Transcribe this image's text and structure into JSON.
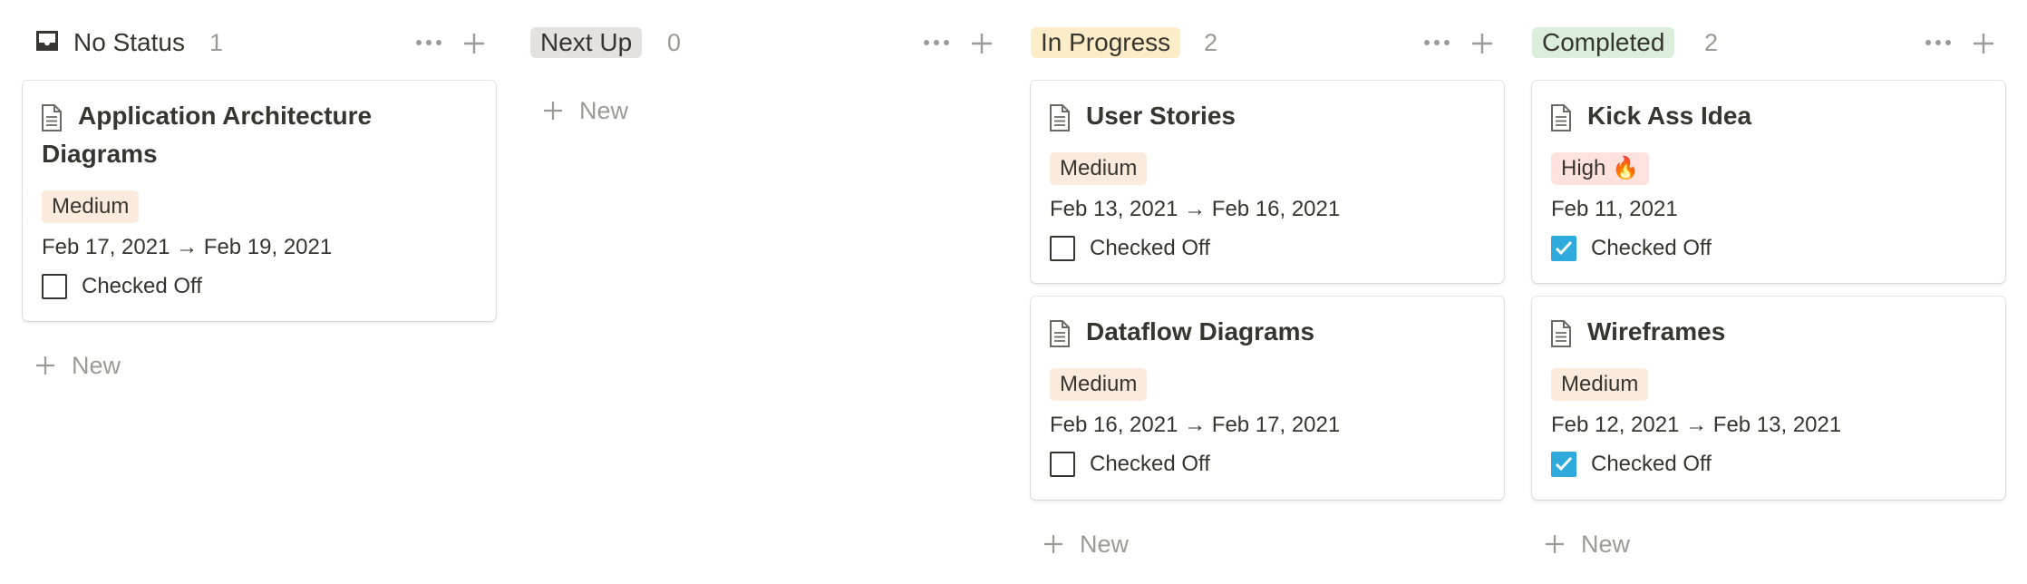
{
  "board": {
    "columns": [
      {
        "title": "No Status",
        "count": "1",
        "pill_bg": "",
        "icon": "inbox-icon",
        "new_label": "New",
        "cards": [
          {
            "title": "Application Architecture Diagrams",
            "title_line1": "Application Architecture",
            "title_line2": "Diagrams",
            "tag": "Medium",
            "tag_color": "#faebdd",
            "date": "Feb 17, 2021 → Feb 19, 2021",
            "checked": false,
            "check_label": "Checked Off"
          }
        ]
      },
      {
        "title": "Next Up",
        "count": "0",
        "pill_bg": "#e3e2e0",
        "new_label": "New",
        "cards": []
      },
      {
        "title": "In Progress",
        "count": "2",
        "pill_bg": "#fdecc8",
        "new_label": "New",
        "cards": [
          {
            "title": "User Stories",
            "tag": "Medium",
            "tag_color": "#faebdd",
            "date": "Feb 13, 2021 → Feb 16, 2021",
            "checked": false,
            "check_label": "Checked Off"
          },
          {
            "title": "Dataflow Diagrams",
            "tag": "Medium",
            "tag_color": "#faebdd",
            "date": "Feb 16, 2021 → Feb 17, 2021",
            "checked": false,
            "check_label": "Checked Off"
          }
        ]
      },
      {
        "title": "Completed",
        "count": "2",
        "pill_bg": "#dbeddb",
        "new_label": "New",
        "cards": [
          {
            "title": "Kick Ass Idea",
            "tag": "High 🔥",
            "tag_color": "#ffe2dd",
            "date": "Feb 11, 2021",
            "checked": true,
            "check_label": "Checked Off"
          },
          {
            "title": "Wireframes",
            "tag": "Medium",
            "tag_color": "#faebdd",
            "date": "Feb 12, 2021 → Feb 13, 2021",
            "checked": true,
            "check_label": "Checked Off"
          }
        ]
      }
    ]
  },
  "colors": {
    "text": "#37352f",
    "muted": "#9b9a97",
    "checkbox_checked": "#2eaadc"
  }
}
